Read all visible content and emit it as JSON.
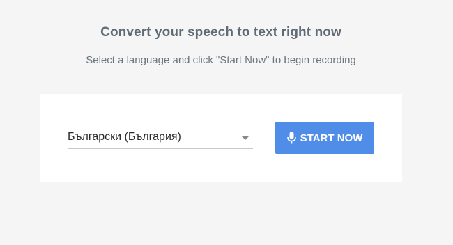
{
  "header": {
    "title": "Convert your speech to text right now",
    "subtitle": "Select a language and click \"Start Now\" to begin recording"
  },
  "language_select": {
    "selected": "Български (България)",
    "arrow_icon": "dropdown-arrow-icon"
  },
  "start_button": {
    "label": "START NOW",
    "icon": "microphone-icon",
    "color": "#4f8de8"
  },
  "colors": {
    "background": "#f5f5f5",
    "card": "#ffffff",
    "title": "#5f6b76"
  }
}
